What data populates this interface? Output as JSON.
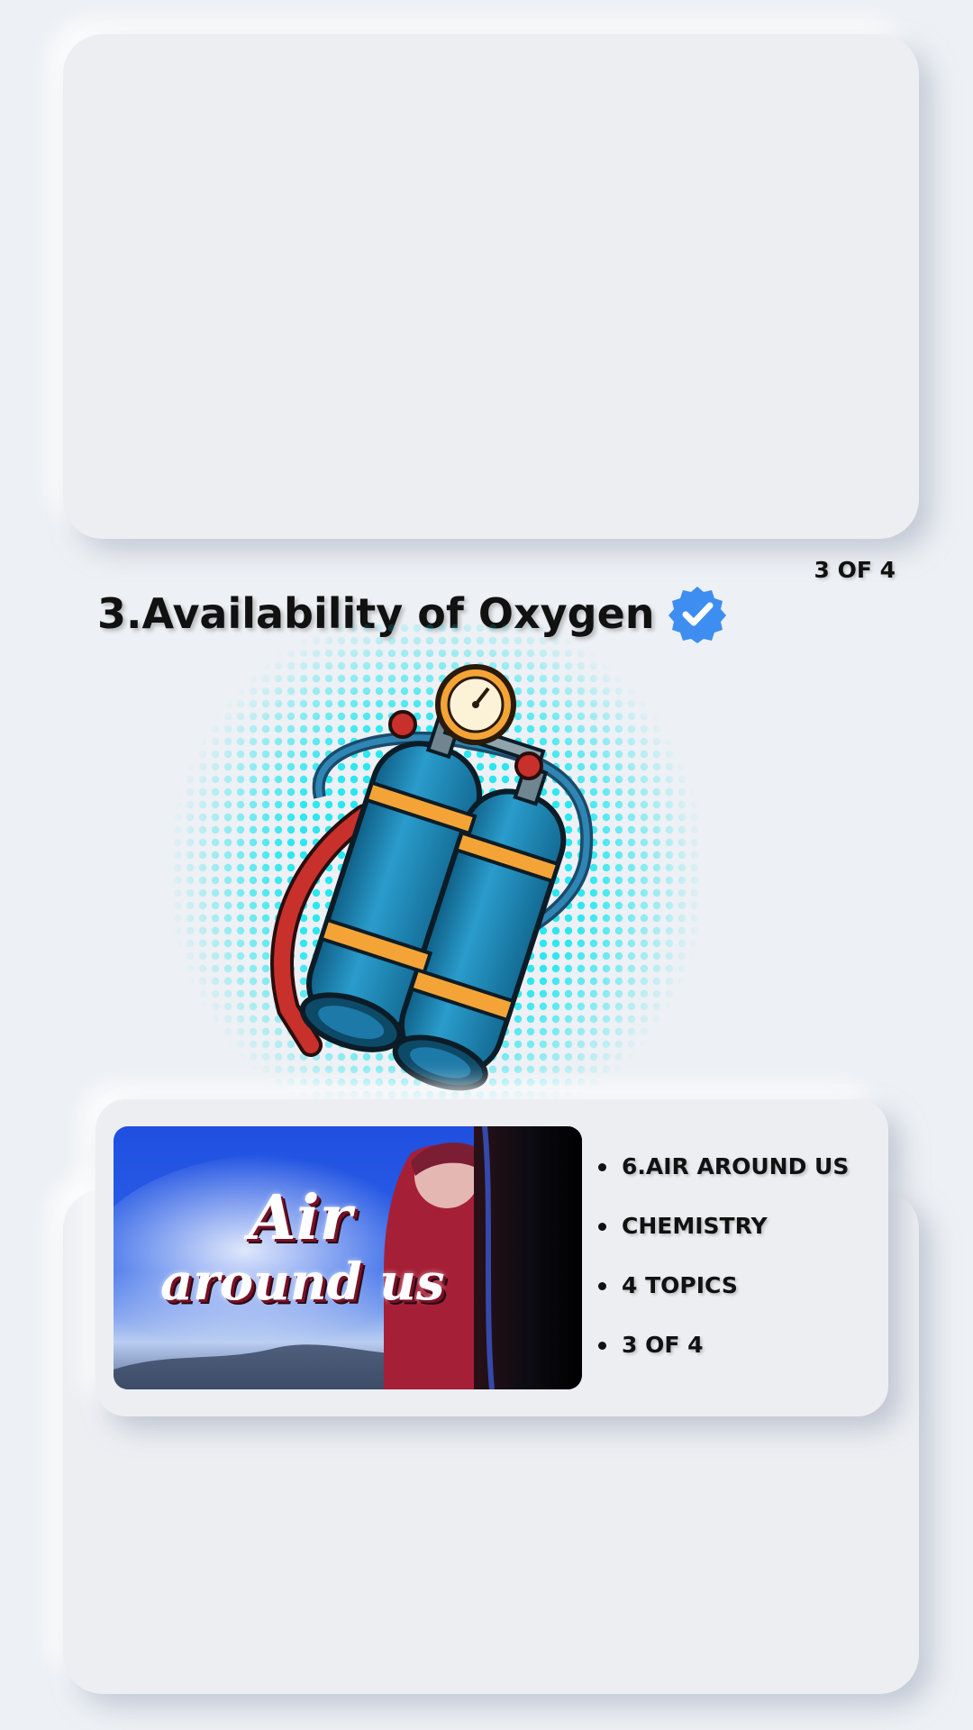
{
  "page": {
    "counter": "3 OF 4",
    "title": "3.Availability of Oxygen",
    "verified_icon": "verified-badge-icon",
    "accent_color": "#3d8ef0"
  },
  "illustration": {
    "icon": "oxygen-tank-icon",
    "halftone_color": "#18e6f0",
    "tank_color": "#1e87b4",
    "band_color": "#f4a436",
    "strap_color": "#c8302c"
  },
  "course_card": {
    "thumbnail_line1": "Air",
    "thumbnail_line2": "around us",
    "items": [
      {
        "label": "6.AIR AROUND US"
      },
      {
        "label": "CHEMISTRY"
      },
      {
        "label": "4 TOPICS"
      },
      {
        "label": "3 OF 4"
      }
    ]
  }
}
